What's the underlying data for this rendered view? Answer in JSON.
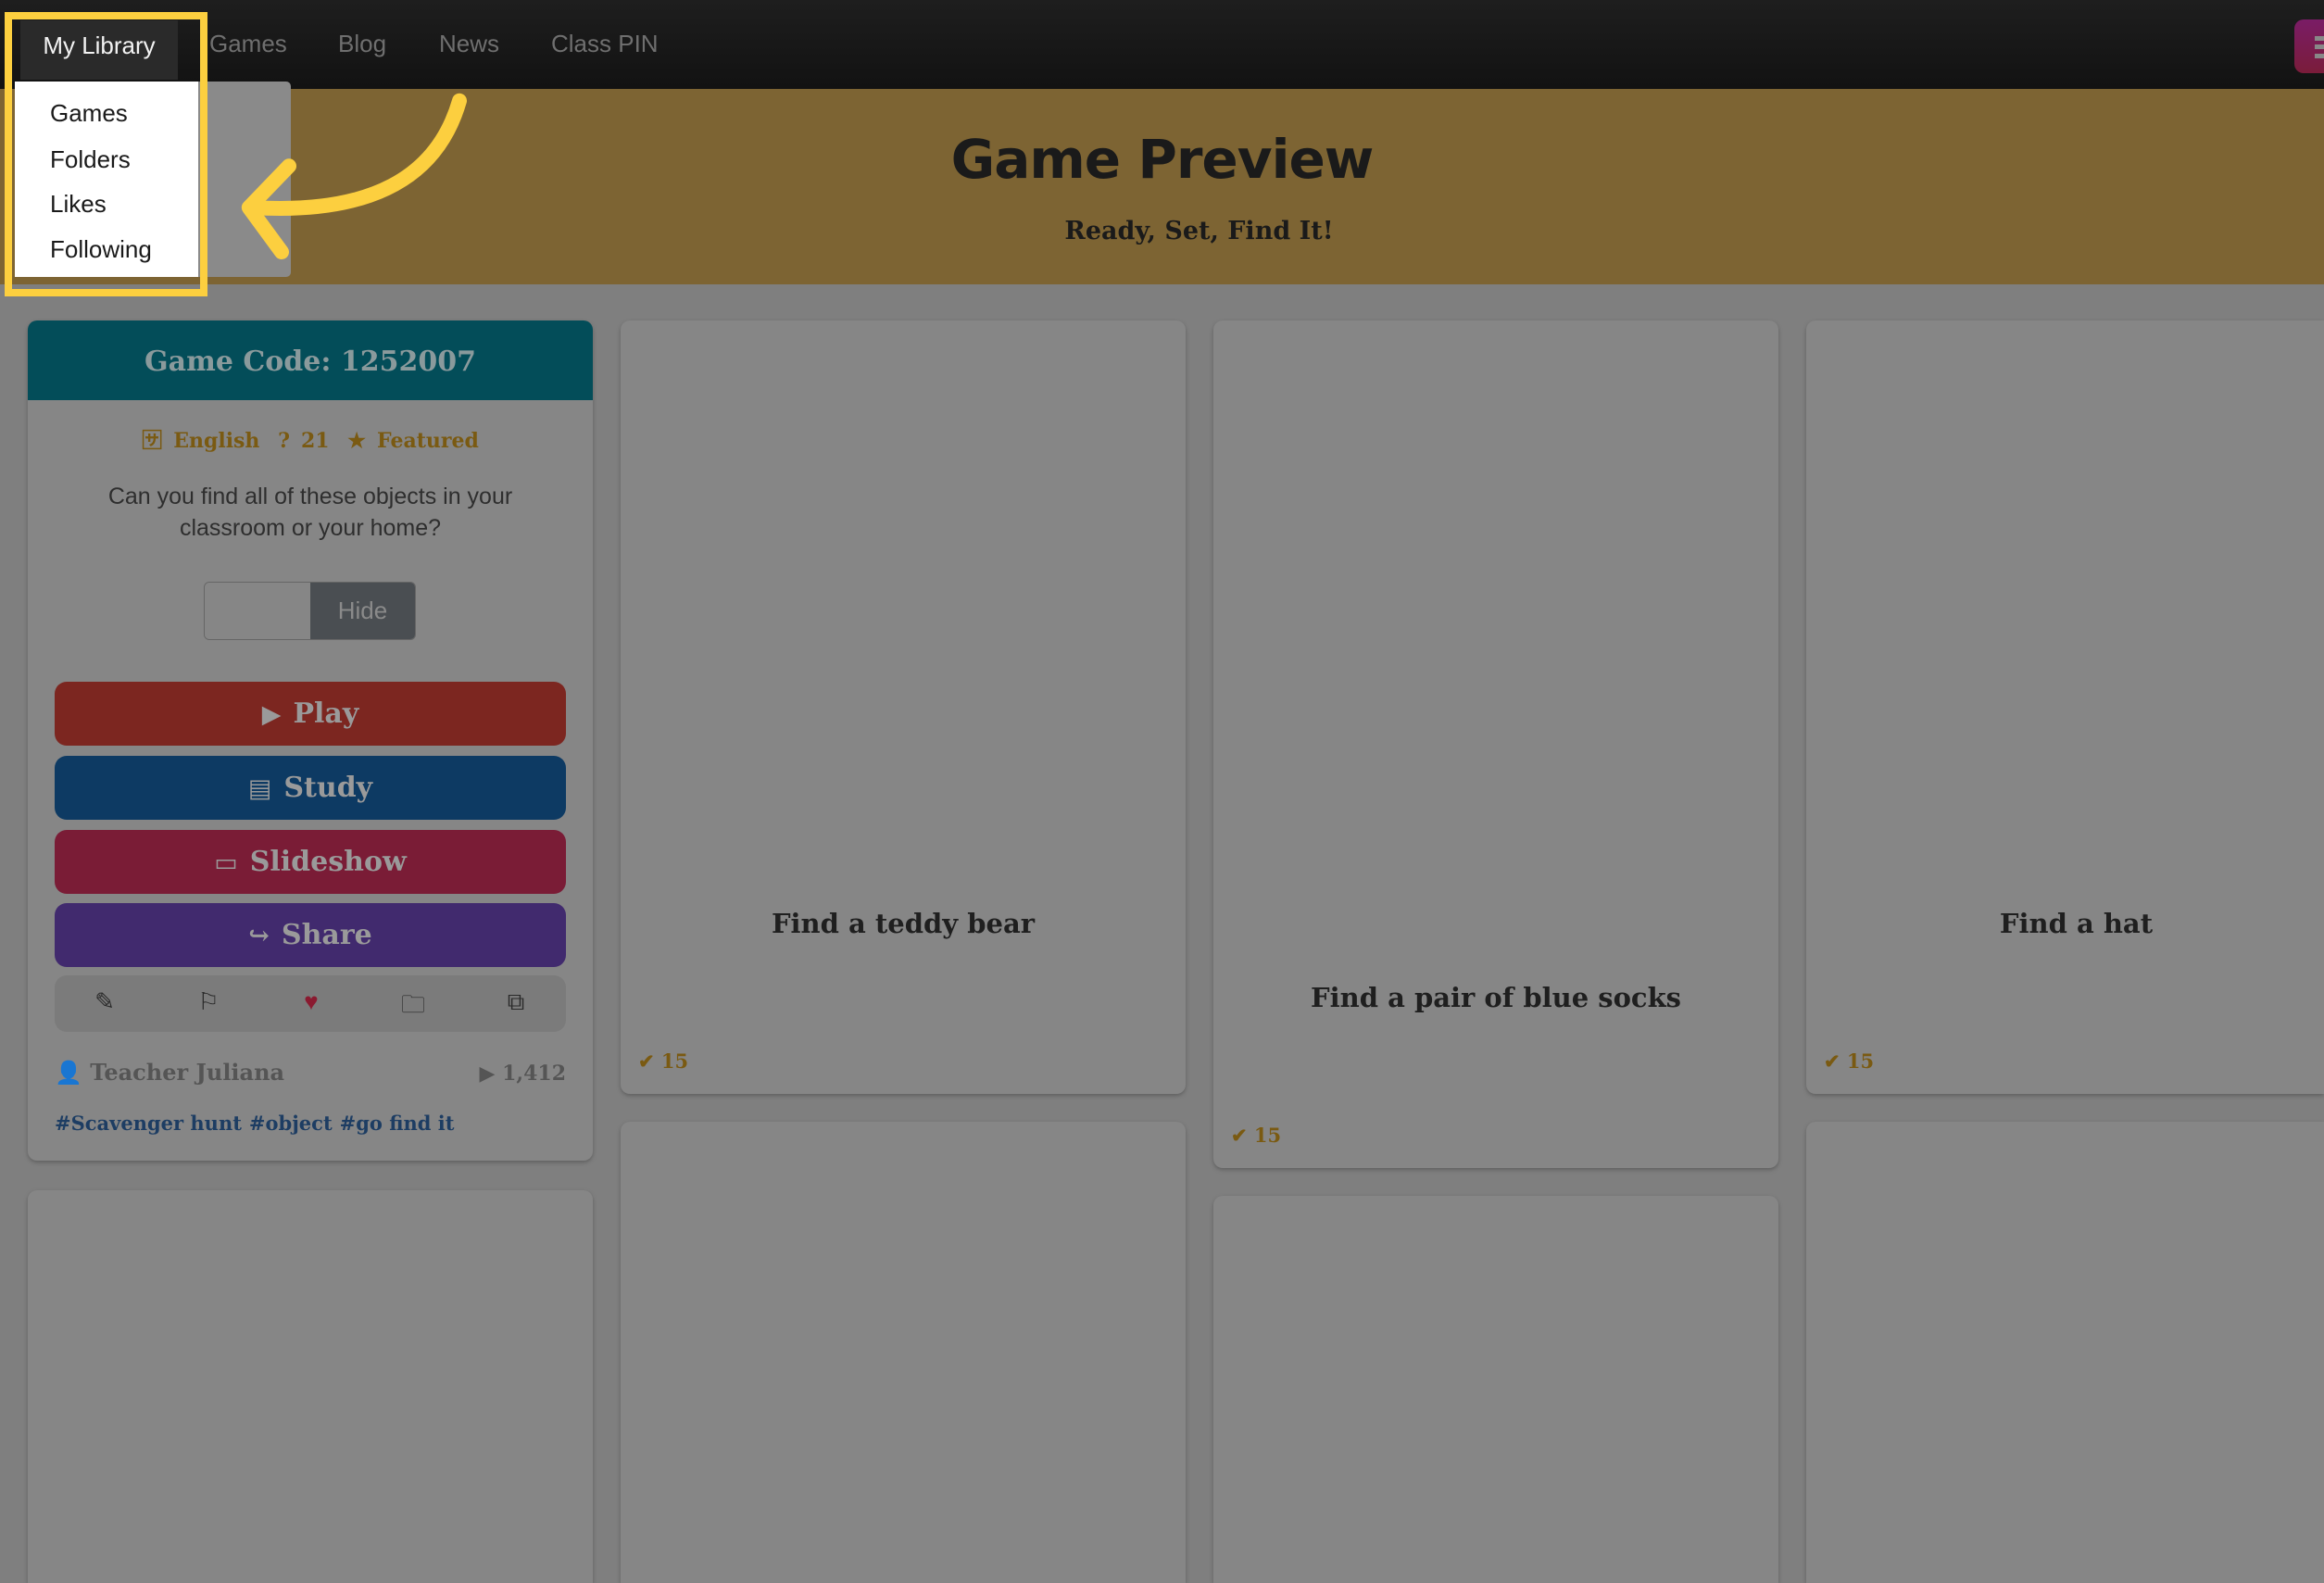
{
  "nav": {
    "active": "My Library",
    "items": [
      "Games",
      "Blog",
      "News",
      "Class PIN"
    ],
    "menu_icon": "hamburger-icon"
  },
  "dropdown": {
    "items": [
      "Games",
      "Folders",
      "Likes",
      "Following"
    ]
  },
  "banner": {
    "title": "Game Preview",
    "subtitle": "Ready, Set, Find It!"
  },
  "game": {
    "code_label": "Game Code: 1252007",
    "language": "English",
    "questions": "21",
    "featured": "Featured",
    "description": "Can you find all of these objects in your classroom or your home?",
    "toggle_label": "Hide",
    "buttons": {
      "play": "Play",
      "study": "Study",
      "slideshow": "Slideshow",
      "share": "Share"
    },
    "author": "Teacher Juliana",
    "plays": "1,412",
    "tags": [
      "#Scavenger hunt",
      "#object",
      "#go find it"
    ]
  },
  "cards": [
    {
      "title": "Find a teddy bear",
      "count": "15"
    },
    {
      "title": "Find a pair of blue socks",
      "count": "15"
    },
    {
      "title": "Find a hat",
      "count": "15"
    }
  ],
  "colors": {
    "highlight": "#fccf3f",
    "banner": "#7d6433",
    "header": "#034d59",
    "play": "#7c2620",
    "study": "#0d3a63",
    "slideshow": "#7a1c36",
    "share": "#412a6e"
  }
}
